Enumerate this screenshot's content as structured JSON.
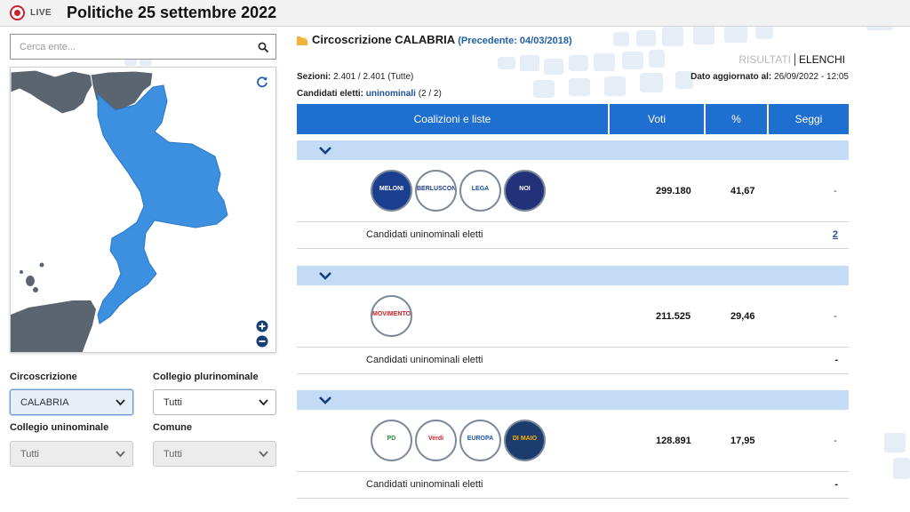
{
  "header": {
    "live_label": "LIVE",
    "title": "Politiche 25 settembre 2022"
  },
  "search": {
    "placeholder": "Cerca ente..."
  },
  "filters": {
    "circoscrizione_label": "Circoscrizione",
    "circoscrizione_value": "CALABRIA",
    "plurinominale_label": "Collegio plurinominale",
    "plurinominale_value": "Tutti",
    "uninominale_label": "Collegio uninominale",
    "uninominale_value": "Tutti",
    "comune_label": "Comune",
    "comune_value": "Tutti"
  },
  "panel": {
    "title": "Circoscrizione CALABRIA",
    "previous": "(Precedente: 04/03/2018)",
    "tab_results": "RISULTATI",
    "tab_lists": "ELENCHI",
    "sections_label": "Sezioni:",
    "sections_value": "2.401 / 2.401 (Tutte)",
    "elected_label": "Candidati eletti:",
    "elected_link": "uninominali",
    "elected_count": "(2 / 2)",
    "updated_label": "Dato aggiornato al:",
    "updated_value": "26/09/2022 - 12:05"
  },
  "table": {
    "headers": [
      "Coalizioni e liste",
      "Voti",
      "%",
      "Seggi"
    ],
    "coalitions": [
      {
        "logos": [
          {
            "name": "fratelli-italia-logo",
            "text": "MELONI",
            "bg": "#1b3f8f",
            "fg": "#ffffff"
          },
          {
            "name": "forza-italia-logo",
            "text": "BERLUSCONI",
            "bg": "#ffffff",
            "fg": "#1b3f8f"
          },
          {
            "name": "lega-logo",
            "text": "LEGA",
            "bg": "#ffffff",
            "fg": "#1b4fa0"
          },
          {
            "name": "noi-moderati-logo",
            "text": "NOI",
            "bg": "#23307a",
            "fg": "#ffffff"
          }
        ],
        "votes": "299.180",
        "percent": "41,67",
        "seats": "-",
        "candidates_label": "Candidati uninominali eletti",
        "candidates_value": "2"
      },
      {
        "logos": [
          {
            "name": "movimento-5-stelle-logo",
            "text": "MOVIMENTO",
            "bg": "#ffffff",
            "fg": "#c21f25"
          }
        ],
        "votes": "211.525",
        "percent": "29,46",
        "seats": "-",
        "candidates_label": "Candidati uninominali eletti",
        "candidates_value": "-"
      },
      {
        "logos": [
          {
            "name": "pd-logo",
            "text": "PD",
            "bg": "#ffffff",
            "fg": "#2a8a3a"
          },
          {
            "name": "verdi-sinistra-logo",
            "text": "Verdi",
            "bg": "#ffffff",
            "fg": "#d02530"
          },
          {
            "name": "piu-europa-logo",
            "text": "EUROPA",
            "bg": "#ffffff",
            "fg": "#1f58b0"
          },
          {
            "name": "impegno-civico-logo",
            "text": "DI MAIO",
            "bg": "#1d3c6e",
            "fg": "#ffb000"
          }
        ],
        "votes": "128.891",
        "percent": "17,95",
        "seats": "-",
        "candidates_label": "Candidati uninominali eletti",
        "candidates_value": "-"
      }
    ]
  },
  "colors": {
    "accent": "#1f6fd0",
    "group_bar": "#c4dbf6",
    "region_fill": "#3d8fdf",
    "neighbor_fill": "#5a6570",
    "live": "#c9242b"
  }
}
